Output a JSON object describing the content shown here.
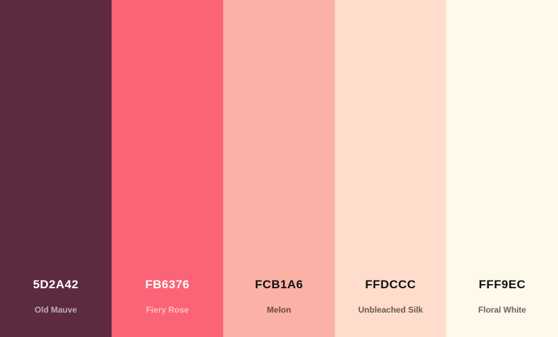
{
  "colors": [
    {
      "hex": "5D2A42",
      "name": "Old Mauve",
      "color": "#5D2A42",
      "text_theme": "dark"
    },
    {
      "hex": "FB6376",
      "name": "Fiery Rose",
      "color": "#FB6376",
      "text_theme": "dark"
    },
    {
      "hex": "FCB1A6",
      "name": "Melon",
      "color": "#FCB1A6",
      "text_theme": "light"
    },
    {
      "hex": "FFDCCC",
      "name": "Unbleached Silk",
      "color": "#FFDCCC",
      "text_theme": "light"
    },
    {
      "hex": "FFF9EC",
      "name": "Floral White",
      "color": "#FFF9EC",
      "text_theme": "light"
    }
  ]
}
